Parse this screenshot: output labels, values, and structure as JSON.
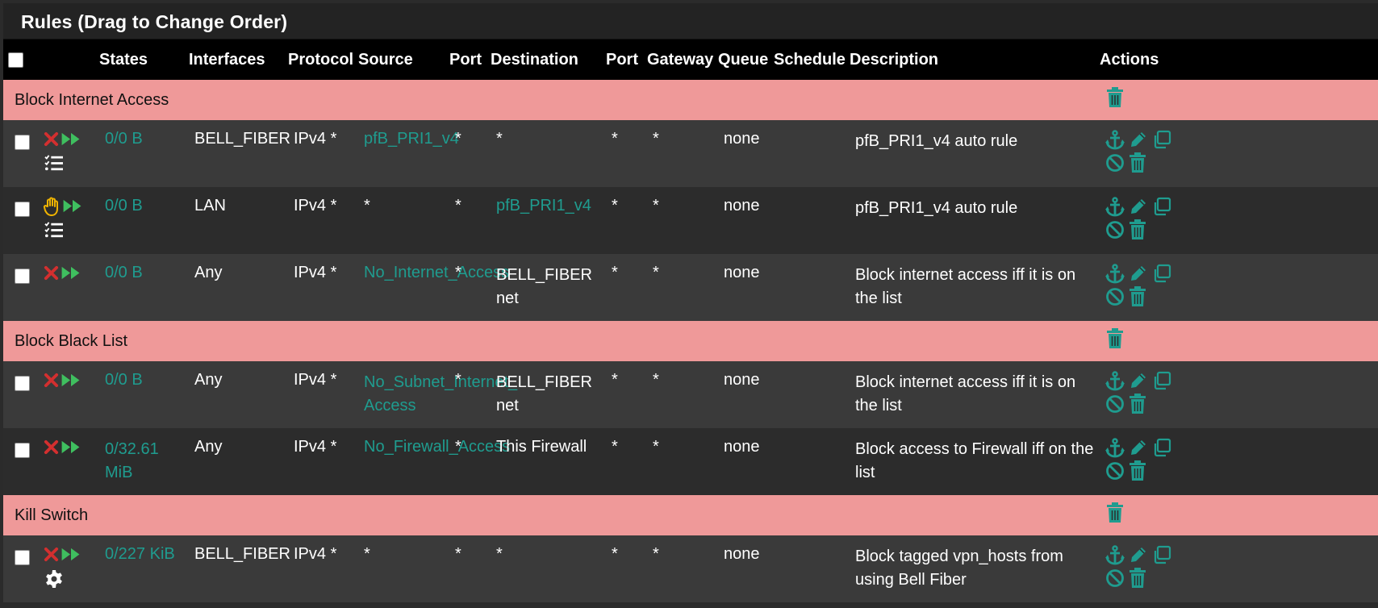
{
  "panel": {
    "title": "Rules (Drag to Change Order)"
  },
  "columns": {
    "states": "States",
    "interfaces": "Interfaces",
    "protocol": "Protocol",
    "source": "Source",
    "source_port": "Port",
    "destination": "Destination",
    "dest_port": "Port",
    "gateway": "Gateway",
    "queue": "Queue",
    "schedule": "Schedule",
    "description": "Description",
    "actions": "Actions"
  },
  "separators": [
    "Block Internet Access",
    "Block Black List",
    "Kill Switch"
  ],
  "rules": [
    {
      "action_icon": "block-x-icon",
      "states": "0/0 B",
      "interface": "BELL_FIBER",
      "protocol": "IPv4 *",
      "source": "pfB_PRI1_v4",
      "source_port": "*",
      "destination": "*",
      "dest_port": "*",
      "gateway": "*",
      "queue": "none",
      "schedule": "",
      "description": "pfB_PRI1_v4 auto rule",
      "extra_icon": "list-check-icon"
    },
    {
      "action_icon": "hand-icon",
      "states": "0/0 B",
      "interface": "LAN",
      "protocol": "IPv4 *",
      "source": "*",
      "source_port": "*",
      "destination": "pfB_PRI1_v4",
      "dest_port": "*",
      "gateway": "*",
      "queue": "none",
      "schedule": "",
      "description": "pfB_PRI1_v4 auto rule",
      "extra_icon": "list-check-icon"
    },
    {
      "action_icon": "block-x-icon",
      "states": "0/0 B",
      "interface": "Any",
      "protocol": "IPv4 *",
      "source": "No_Internet_Access",
      "source_port": "*",
      "destination": "BELL_FIBER net",
      "dest_port": "*",
      "gateway": "*",
      "queue": "none",
      "schedule": "",
      "description": "Block internet access iff it is on the list"
    },
    {
      "action_icon": "block-x-icon",
      "states": "0/0 B",
      "interface": "Any",
      "protocol": "IPv4 *",
      "source": "No_Subnet_Internet_ Access",
      "source_port": "*",
      "destination": "BELL_FIBER net",
      "dest_port": "*",
      "gateway": "*",
      "queue": "none",
      "schedule": "",
      "description": "Block internet access iff it is on the list"
    },
    {
      "action_icon": "block-x-icon",
      "states": "0/32.61 MiB",
      "interface": "Any",
      "protocol": "IPv4 *",
      "source": "No_Firewall_Access",
      "source_port": "*",
      "destination": "This Firewall",
      "dest_port": "*",
      "gateway": "*",
      "queue": "none",
      "schedule": "",
      "description": "Block access to Firewall iff on the list"
    },
    {
      "action_icon": "block-x-icon",
      "states": "0/227 KiB",
      "interface": "BELL_FIBER",
      "protocol": "IPv4 *",
      "source": "*",
      "source_port": "*",
      "destination": "*",
      "dest_port": "*",
      "gateway": "*",
      "queue": "none",
      "schedule": "",
      "description": "Block tagged vpn_hosts from using Bell Fiber",
      "extra_icon": "gear-icon"
    }
  ],
  "colors": {
    "separator": "#ef9999",
    "accent": "#1f9c8f",
    "block": "#d32f2f",
    "pass": "#3fbf5f",
    "match": "#f0b400"
  }
}
